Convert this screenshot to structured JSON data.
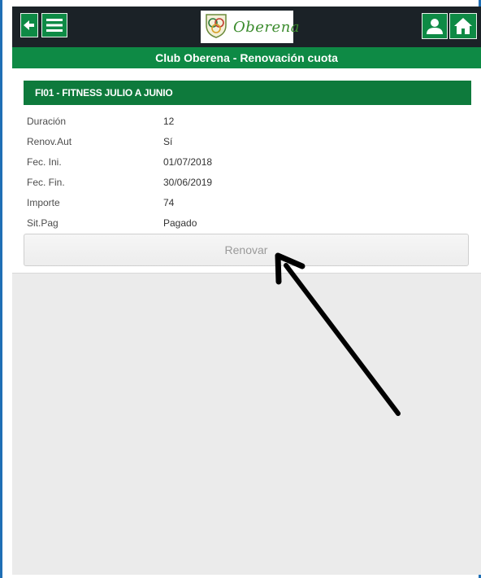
{
  "header": {
    "logo_text": "Oberena",
    "title": "Club Oberena - Renovación cuota"
  },
  "icons": {
    "back": "arrow-left-icon",
    "menu": "hamburger-menu-icon",
    "user": "user-icon",
    "home": "home-icon"
  },
  "card": {
    "title": "FI01 - FITNESS JULIO A JUNIO",
    "rows": [
      {
        "label": "Duración",
        "value": "12"
      },
      {
        "label": "Renov.Aut",
        "value": "Sí"
      },
      {
        "label": "Fec. Ini.",
        "value": "01/07/2018"
      },
      {
        "label": "Fec. Fin.",
        "value": "30/06/2019"
      },
      {
        "label": "Importe",
        "value": "74"
      },
      {
        "label": "Sit.Pag",
        "value": "Pagado"
      }
    ],
    "renew_label": "Renovar"
  },
  "colors": {
    "accent_green": "#0e8a45",
    "topbar_dark": "#1b2227"
  }
}
